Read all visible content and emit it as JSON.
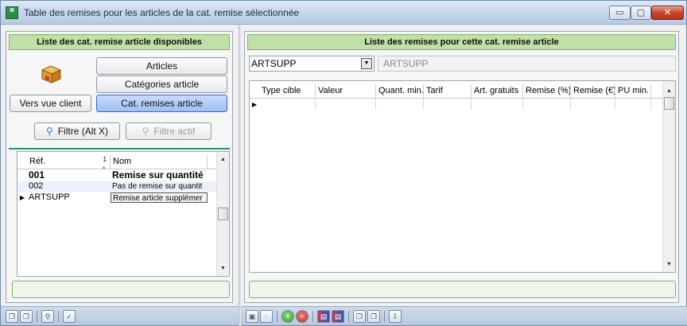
{
  "window": {
    "title": "Table des remises pour les articles de la cat. remise sélectionnée",
    "buttons": {
      "minimize": "▭",
      "maximize": "▢",
      "close": "✕"
    }
  },
  "left_panel": {
    "header": "Liste des cat. remise article disponibles",
    "buttons": {
      "articles": "Articles",
      "categories": "Catégories article",
      "vers_client": "Vers vue client",
      "cat_remises": "Cat. remises article",
      "filtre": "Filtre (Alt X)",
      "filtre_actif": "Filtre actif"
    },
    "grid": {
      "columns": [
        "Réf.",
        "Nom"
      ],
      "sort_marker": "1",
      "rows": [
        {
          "ref": "001",
          "nom": "Remise sur quantité"
        },
        {
          "ref": "002",
          "nom": "Pas de remise sur quantit"
        },
        {
          "ref": "ARTSUPP",
          "nom": "Remise article supplémer"
        }
      ]
    }
  },
  "right_panel": {
    "header": "Liste des remises pour cette cat. remise article",
    "select_value": "ARTSUPP",
    "readonly_value": "ARTSUPP",
    "grid": {
      "columns": [
        "Type cible",
        "Valeur",
        "Quant. min.",
        "Tarif",
        "Art. gratuits",
        "Remise (%)",
        "Remise (€)",
        "PU min."
      ]
    }
  },
  "icons": [
    "app-icon",
    "box-icon",
    "filter-icon",
    "row-pointer-icon",
    "dropdown-arrow-icon"
  ],
  "colors": {
    "header_green": "#bfe0a6",
    "active_blue": "#9fbff4",
    "separator_teal": "#20947c"
  }
}
